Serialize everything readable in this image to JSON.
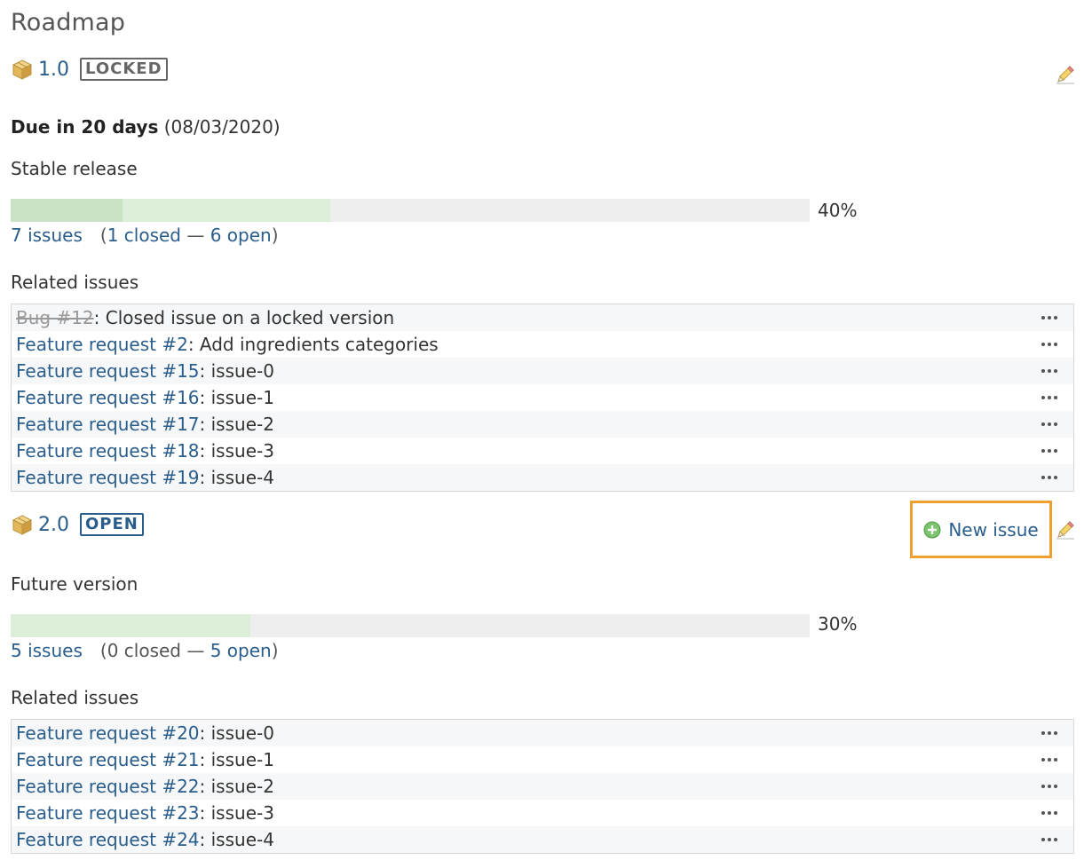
{
  "page": {
    "title": "Roadmap"
  },
  "versions": [
    {
      "name": "1.0",
      "status": "LOCKED",
      "due_label": "Due in 20 days",
      "due_date": "(08/03/2020)",
      "description": "Stable release",
      "progress": {
        "closed_percent": 14,
        "done_percent": 40,
        "label": "40%"
      },
      "issues_count": "7 issues",
      "open_paren": "(",
      "closed_count": "1 closed",
      "separator": " — ",
      "open_count": "6 open",
      "close_paren": ")",
      "related_heading": "Related issues",
      "issues": [
        {
          "ref": "Bug #12",
          "subject": ": Closed issue on a locked version",
          "closed": true
        },
        {
          "ref": "Feature request #2",
          "subject": ": Add ingredients categories",
          "closed": false
        },
        {
          "ref": "Feature request #15",
          "subject": ": issue-0",
          "closed": false
        },
        {
          "ref": "Feature request #16",
          "subject": ": issue-1",
          "closed": false
        },
        {
          "ref": "Feature request #17",
          "subject": ": issue-2",
          "closed": false
        },
        {
          "ref": "Feature request #18",
          "subject": ": issue-3",
          "closed": false
        },
        {
          "ref": "Feature request #19",
          "subject": ": issue-4",
          "closed": false
        }
      ]
    },
    {
      "name": "2.0",
      "status": "OPEN",
      "new_issue_label": "New issue",
      "description": "Future version",
      "progress": {
        "closed_percent": 0,
        "done_percent": 30,
        "label": "30%"
      },
      "issues_count": "5 issues",
      "open_paren": "(",
      "closed_count": "0 closed",
      "separator": " — ",
      "open_count": "5 open",
      "close_paren": ")",
      "related_heading": "Related issues",
      "issues": [
        {
          "ref": "Feature request #20",
          "subject": ": issue-0",
          "closed": false
        },
        {
          "ref": "Feature request #21",
          "subject": ": issue-1",
          "closed": false
        },
        {
          "ref": "Feature request #22",
          "subject": ": issue-2",
          "closed": false
        },
        {
          "ref": "Feature request #23",
          "subject": ": issue-3",
          "closed": false
        },
        {
          "ref": "Feature request #24",
          "subject": ": issue-4",
          "closed": false
        }
      ]
    }
  ],
  "colors": {
    "link": "#2a5d8c",
    "closed_fill": "#c8e2c3",
    "done_fill": "#dcedd8",
    "highlight": "#f0a030"
  },
  "icons": {
    "version": "package-icon",
    "edit": "pencil-icon",
    "more": "ellipsis-icon",
    "add": "plus-circle-icon"
  }
}
